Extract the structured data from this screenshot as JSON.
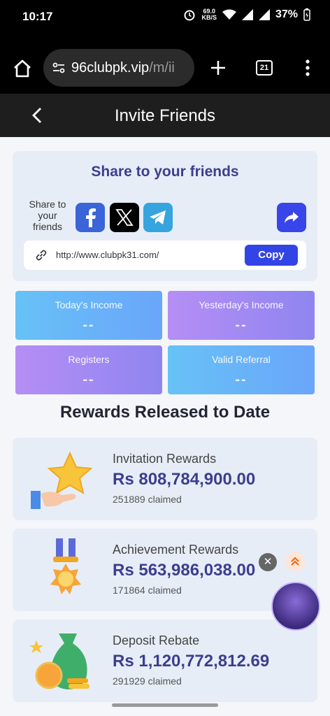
{
  "status_bar": {
    "time": "10:17",
    "net_speed_value": "69.0",
    "net_speed_unit": "KB/S",
    "battery": "37%"
  },
  "browser": {
    "url_main": "96clubpk.vip",
    "url_path": "/m/ii",
    "tab_count": "21"
  },
  "header": {
    "title": "Invite Friends"
  },
  "share": {
    "heading": "Share to your friends",
    "label_line1": "Share to",
    "label_line2": "your",
    "label_line3": "friends",
    "link": "http://www.clubpk31.com/",
    "copy_label": "Copy"
  },
  "stats": [
    {
      "label": "Today's Income",
      "value": "--"
    },
    {
      "label": "Yesterday's Income",
      "value": "--"
    },
    {
      "label": "Registers",
      "value": "--"
    },
    {
      "label": "Valid Referral",
      "value": "--"
    }
  ],
  "rewards_title": "Rewards Released to Date",
  "rewards": [
    {
      "name": "Invitation Rewards",
      "amount": "Rs 808,784,900.00",
      "claimed": "251889 claimed"
    },
    {
      "name": "Achievement Rewards",
      "amount": "Rs 563,986,038.00",
      "claimed": "171864 claimed"
    },
    {
      "name": "Deposit Rebate",
      "amount": "Rs 1,120,772,812.69",
      "claimed": "291929 claimed"
    }
  ],
  "colors": {
    "accent": "#3344e6",
    "heading": "#3b3f8e",
    "card_bg": "#e7edf7"
  }
}
